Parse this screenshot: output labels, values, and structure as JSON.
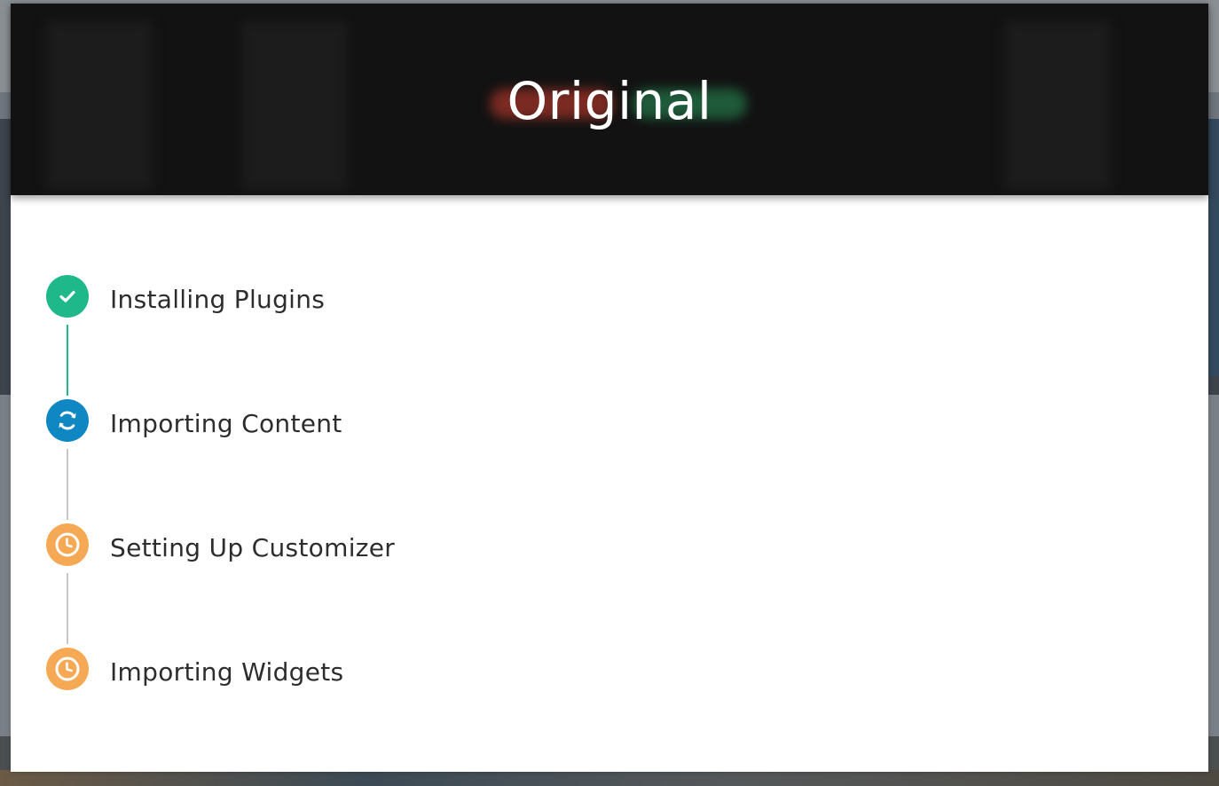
{
  "modal": {
    "title": "Original"
  },
  "steps": [
    {
      "label": "Installing Plugins",
      "status": "complete",
      "icon": "check-icon",
      "color": "#1fb88a"
    },
    {
      "label": "Importing Content",
      "status": "in-progress",
      "icon": "sync-icon",
      "color": "#0e87c2"
    },
    {
      "label": "Setting Up Customizer",
      "status": "pending",
      "icon": "clock-icon",
      "color": "#f5a954"
    },
    {
      "label": "Importing Widgets",
      "status": "pending",
      "icon": "clock-icon",
      "color": "#f5a954"
    }
  ],
  "colors": {
    "complete": "#1fb88a",
    "in_progress": "#0e87c2",
    "pending": "#f5a954",
    "connector_done": "#1fb88a",
    "connector_pending": "#c8c8c8",
    "header_bg": "#121212"
  }
}
